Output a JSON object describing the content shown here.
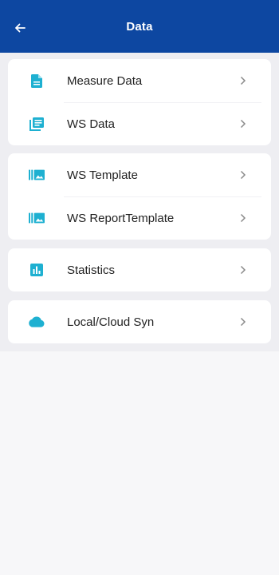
{
  "header": {
    "title": "Data"
  },
  "colors": {
    "header_bg": "#0d47a1",
    "icon": "#1eb0d1",
    "chevron": "#8a8a8a",
    "content_bg": "#eeeef2",
    "page_bg": "#f7f7f9"
  },
  "groups": [
    {
      "items": [
        {
          "label": "Measure Data",
          "icon": "document-icon"
        },
        {
          "label": "WS Data",
          "icon": "stacked-list-icon"
        }
      ]
    },
    {
      "items": [
        {
          "label": "WS Template",
          "icon": "template-image-icon"
        },
        {
          "label": "WS ReportTemplate",
          "icon": "template-image-icon"
        }
      ]
    },
    {
      "items": [
        {
          "label": "Statistics",
          "icon": "bar-chart-icon"
        }
      ]
    },
    {
      "items": [
        {
          "label": "Local/Cloud Syn",
          "icon": "cloud-icon"
        }
      ]
    }
  ]
}
